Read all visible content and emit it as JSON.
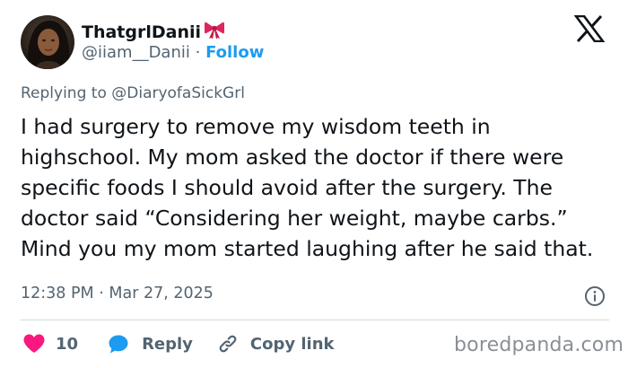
{
  "author": {
    "display_name": "ThatgrlDanii",
    "handle": "@iiam__Danii",
    "separator": "·",
    "follow_label": "Follow"
  },
  "reply_context": {
    "prefix": "Replying to",
    "mention": "@DiaryofaSickGrl"
  },
  "tweet": {
    "text": "I had surgery to remove my wisdom teeth in highschool. My mom asked the doctor if there were specific foods I should avoid after the surgery. The doctor said “Considering her weight, maybe carbs.” Mind you my mom started laughing after he said that.",
    "time": "12:38 PM",
    "separator": "·",
    "date": "Mar 27, 2025"
  },
  "actions": {
    "like_count": "10",
    "reply_label": "Reply",
    "copy_link_label": "Copy link"
  },
  "watermark": "boredpanda.com",
  "colors": {
    "heart": "#f91880",
    "link_blue": "#1d9bf0",
    "secondary_text": "#536471",
    "bow": "#e0245e"
  },
  "icons": {
    "logo": "x-logo-icon",
    "bow": "ribbon-bow-icon",
    "like": "heart-icon",
    "reply": "speech-bubble-icon",
    "copy_link": "link-icon",
    "info": "info-icon"
  }
}
